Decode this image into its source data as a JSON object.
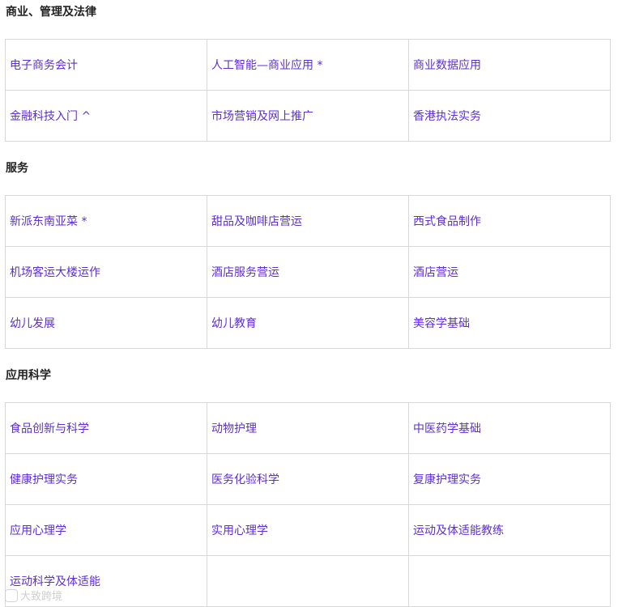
{
  "sections": [
    {
      "title": "商业、管理及法律",
      "rows": [
        [
          "电子商务会计",
          "人工智能—商业应用 *",
          "商业数据应用"
        ],
        [
          "金融科技入门 ^",
          "市场营销及网上推广",
          "香港执法实务"
        ]
      ]
    },
    {
      "title": "服务",
      "rows": [
        [
          "新派东南亚菜 *",
          "甜品及咖啡店营运",
          "西式食品制作"
        ],
        [
          "机场客运大楼运作",
          "酒店服务营运",
          "酒店营运"
        ],
        [
          "幼儿发展",
          "幼儿教育",
          "美容学基础"
        ]
      ]
    },
    {
      "title": "应用科学",
      "rows": [
        [
          "食品创新与科学",
          "动物护理",
          "中医药学基础"
        ],
        [
          "健康护理实务",
          "医务化验科学",
          "复康护理实务"
        ],
        [
          "应用心理学",
          "实用心理学",
          "运动及体适能教练"
        ],
        [
          "运动科学及体适能",
          "",
          ""
        ]
      ]
    }
  ],
  "watermark": {
    "text": "大致跨境"
  },
  "colors": {
    "link": "#5b2fd6",
    "border": "#d8d8d8",
    "heading": "#222222"
  }
}
